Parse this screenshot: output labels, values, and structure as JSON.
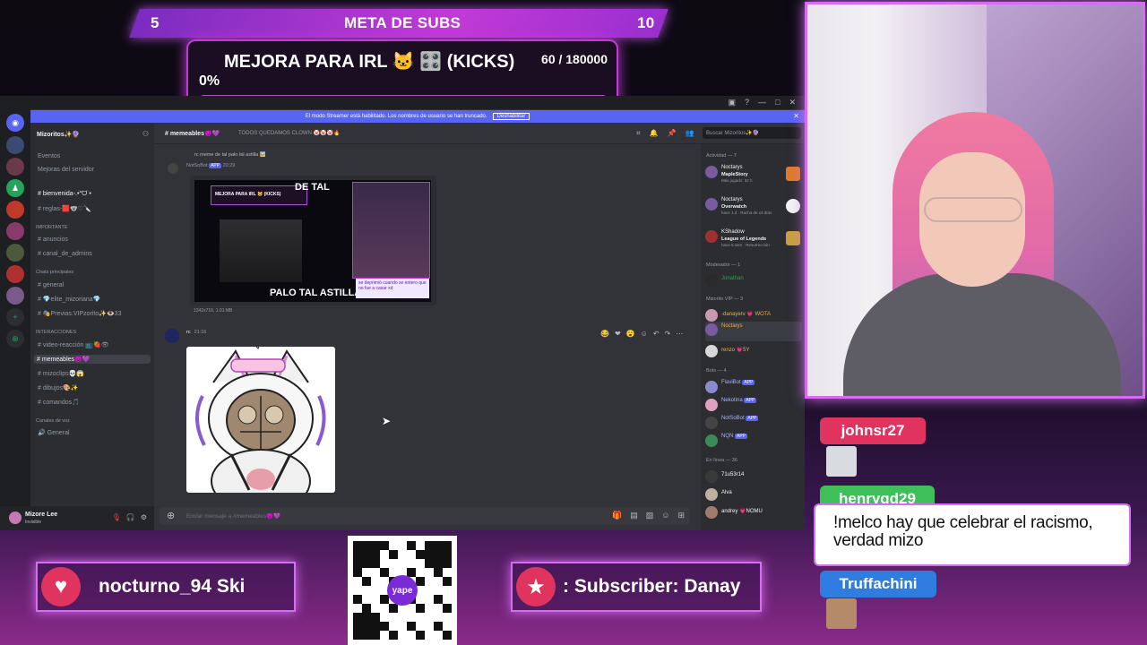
{
  "overlay": {
    "subs_goal": {
      "label": "META DE SUBS",
      "min": "5",
      "max": "10"
    },
    "donation_goal": {
      "title": "MEJORA PARA IRL 🐱 🎛️ (KICKS)",
      "count": "60 / 180000",
      "percent_label": "0%",
      "progress": 0.0003
    }
  },
  "discord": {
    "streamer_banner": {
      "text": "El modo Streamer está habilitado. Los nombres de usuario se han truncado.",
      "button": "Deshabilitar"
    },
    "server": {
      "name": "Mizoritos✨🔮"
    },
    "channels": [
      {
        "label": "Eventos"
      },
      {
        "label": "Mejoras del servidor"
      },
      {
        "label": "# bienvenida-.•°ᗜ˙•"
      },
      {
        "label": "# reglas-🟥🐨♡🔪"
      },
      {
        "label": "IMPORTANTE"
      },
      {
        "label": "# anuncios"
      },
      {
        "label": "# canal_de_admins"
      },
      {
        "label": "Chats principales"
      },
      {
        "label": "# general"
      },
      {
        "label": "# 💎elite_mizoriana💎"
      },
      {
        "label": "# 🎭Previas.VIPzorito✨👁️33"
      },
      {
        "label": "INTERACCIONES"
      },
      {
        "label": "# video-reacción 📺🍓👁"
      },
      {
        "label": "# memeables😈💜"
      },
      {
        "label": "# mizoclips💀😱"
      },
      {
        "label": "# dibujos🎨✨"
      },
      {
        "label": "# comandos🎵"
      },
      {
        "label": "Canales de voz"
      },
      {
        "label": "🔊 General"
      }
    ],
    "user": {
      "name": "Mizore Lee",
      "status": "Invisible"
    },
    "chat_header": {
      "channel": "# memeables😈💜",
      "topic": "TODOS QUEDAMOS CLOWN 🤡🤡🤡🔥",
      "search_placeholder": "Buscar Mizoritos✨🔮"
    },
    "messages": {
      "reply_text": "rc  meme de tal palo tal astilla 🖼️",
      "bot_author": "NotSoBot",
      "app_tag": "APP",
      "bot_time": "20:29",
      "thumb_top_text": "DE TAL",
      "thumb_bottom_text": "PALO TAL ASTILLA",
      "thumb_goal_text": "MEJORA PARA IRL 🐱 (KICKS)",
      "thumb_sub_text": "se deprimió cuando se entero que no fue a casar xd",
      "file_meta": "1342x716, 1.01 MB",
      "second_author": "rc",
      "second_time": "21:16"
    },
    "input_placeholder": "Enviar mensaje a #memeables😈💜",
    "members": {
      "activity_label": "Actividad — 7",
      "activity": [
        {
          "name": "Noctarys",
          "game": "MapleStory",
          "detail": "Más jugado: 32 h"
        },
        {
          "name": "Noctarys",
          "game": "Overwatch",
          "detail": "hace 1 d · Racha de x3 días"
        },
        {
          "name": "KShadow",
          "game": "League of Legends",
          "detail": "hace 5 sem · Resurrección"
        }
      ],
      "moderator_label": "Moderador — 1",
      "moderators": [
        {
          "name": "Jonathan"
        }
      ],
      "vip_label": "Mizorito VIP — 3",
      "vips": [
        {
          "name": "-danayerv 💗 WOTA"
        },
        {
          "name": "Noctarys"
        },
        {
          "name": "renzo 💗5Y"
        }
      ],
      "bots_label": "Bots — 4",
      "bots": [
        {
          "name": "FlaviBot",
          "tag": "APP"
        },
        {
          "name": "Nekotina",
          "tag": "APP"
        },
        {
          "name": "NotSoBot",
          "tag": "APP"
        },
        {
          "name": "NQN",
          "tag": "APP"
        }
      ],
      "online_label": "En línea — 36",
      "online": [
        {
          "name": "71u53r14"
        },
        {
          "name": "Alva"
        },
        {
          "name": "andrey 💗NOMU"
        }
      ]
    }
  },
  "stream_chat": {
    "users": [
      {
        "name": "johnsr27"
      },
      {
        "name": "henrygd29"
      },
      {
        "name": "Truffachini"
      }
    ],
    "message": "!melco hay que celebrar el racismo, verdad mizo"
  },
  "alerts": {
    "left": "nocturno_94   Ski",
    "right": ": Subscriber: Danay",
    "qr_logo": "yape"
  },
  "colors": {
    "accent": "#d56cf2",
    "discord_bg": "#313338",
    "blurple": "#5865f2"
  }
}
